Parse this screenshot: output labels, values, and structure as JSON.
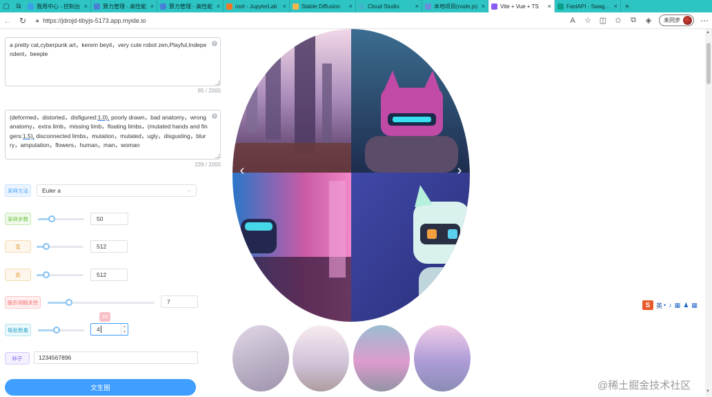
{
  "browser": {
    "tabs": [
      {
        "label": "我用中心 - 控制台",
        "fav": "#3aa0e8",
        "active": false
      },
      {
        "label": "算力管理 - 高性能",
        "fav": "#4a7fd6",
        "active": false
      },
      {
        "label": "算力管理 - 高性能",
        "fav": "#4a7fd6",
        "active": false
      },
      {
        "label": "root - JupyterLab",
        "fav": "#f37726",
        "active": false
      },
      {
        "label": "Stable Diffusion",
        "fav": "#f2b84b",
        "active": false
      },
      {
        "label": "Cloud Studio",
        "fav": "#3fb6c8",
        "active": false
      },
      {
        "label": "本地项目(node.js)",
        "fav": "#6a8fd8",
        "active": false
      },
      {
        "label": "Vite + Vue + TS",
        "fav": "#8a5cf5",
        "active": true
      },
      {
        "label": "FastAPI - Swagger",
        "fav": "#0b9e8a",
        "active": false
      }
    ],
    "url": "https://jdrojd-tibyjs-5173.app.myide.io",
    "profile_label": "未同步"
  },
  "form": {
    "prompt": "a pretty cat,cyberpunk art，kerem beyit，very cute robot zen,Playful,Independent，beeple",
    "prompt_count": "85 / 2000",
    "negative_parts": [
      "(deformed，distorted，disfigured:",
      "1.0),",
      " poorly drawn，bad anatomy，wrong anatomy，extra limb，missing limb，floating limbs，(mutated hands and fingers:",
      "1.5),",
      " disconnected limbs，mutation，mutated，ugly，disgusting，blurry，amputation，flowers，human，man，woman"
    ],
    "negative_count": "239 / 2000",
    "sampler_tag": "采样方法",
    "sampler_value": "Euler a",
    "steps_tag": "采样步数",
    "steps_value": "50",
    "width_tag": "宽",
    "width_value": "512",
    "height_tag": "高",
    "height_value": "512",
    "cfg_tag": "提示词相关性",
    "cfg_value": "7",
    "batch_tag": "每批数量",
    "batch_value": "4",
    "seed_tag": "种子",
    "seed_value": "1234567896",
    "generate_label": "文生图",
    "tip_text": "10"
  },
  "sliders": {
    "steps": 0.3,
    "width": 0.2,
    "height": 0.2,
    "cfg": 0.2,
    "batch": 0.4
  },
  "ime": {
    "logo": "S",
    "lang": "英"
  },
  "watermark": "@稀土掘金技术社区",
  "colors": {
    "tabbar": "#2ec4c4",
    "primary": "#409eff"
  }
}
